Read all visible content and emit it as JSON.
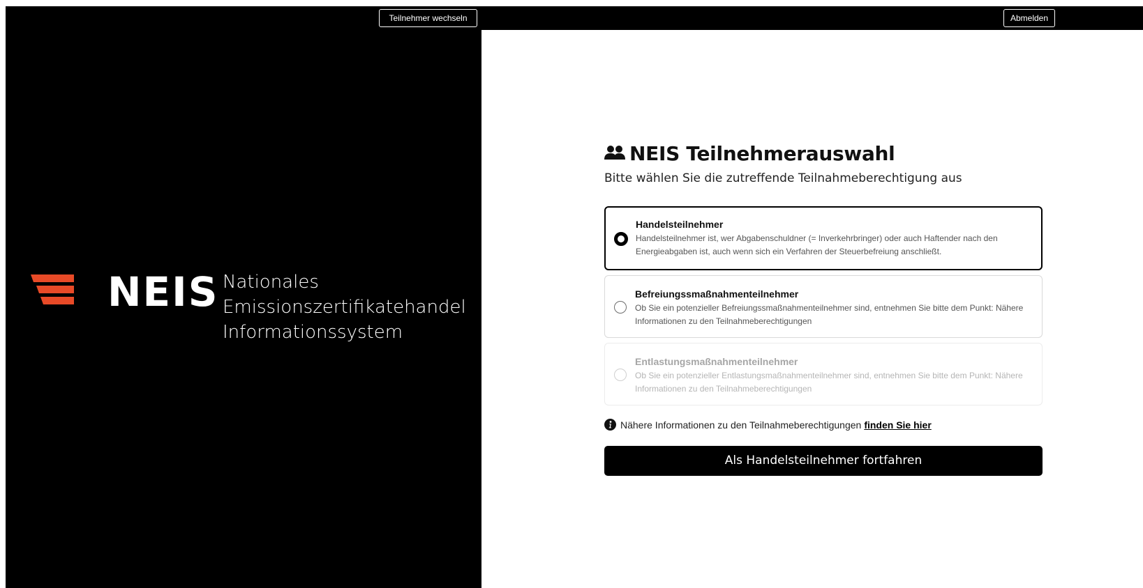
{
  "header": {
    "switch_participant_label": "Teilnehmer wechseln",
    "logout_label": "Abmelden"
  },
  "branding": {
    "logo_text": "NEIS",
    "tagline_lines": [
      "Nationales",
      "Emissionszertifikatehandel",
      "Informationssystem"
    ],
    "logo_color": "#e84a27"
  },
  "main": {
    "title_icon": "users-icon",
    "title": "NEIS Teilnehmerauswahl",
    "subtitle": "Bitte wählen Sie die zutreffende Teilnahmeberechtigung aus",
    "options": [
      {
        "title": "Handelsteilnehmer",
        "description": "Handelsteilnehmer ist, wer Abgabenschuldner (= Inverkehrbringer) oder auch Haftender nach den Energieabgaben ist, auch wenn sich ein Verfahren der Steuerbefreiung anschließt.",
        "selected": true,
        "disabled": false
      },
      {
        "title": "Befreiungssmaßnahmenteilnehmer",
        "description": "Ob Sie ein potenzieller Befreiungssmaßnahmenteilnehmer sind, entnehmen Sie bitte dem Punkt: Nähere Informationen zu den Teilnahmeberechtigungen",
        "selected": false,
        "disabled": false
      },
      {
        "title": "Entlastungsmaßnahmenteilnehmer",
        "description": "Ob Sie ein potenzieller Entlastungsmaßnahmenteilnehmer sind, entnehmen Sie bitte dem Punkt: Nähere Informationen zu den Teilnahmeberechtigungen",
        "selected": false,
        "disabled": true
      }
    ],
    "info_icon": "info-icon",
    "info_text": "Nähere Informationen zu den Teilnahmeberechtigungen",
    "info_link": "finden Sie hier",
    "continue_label": "Als Handelsteilnehmer fortfahren"
  }
}
